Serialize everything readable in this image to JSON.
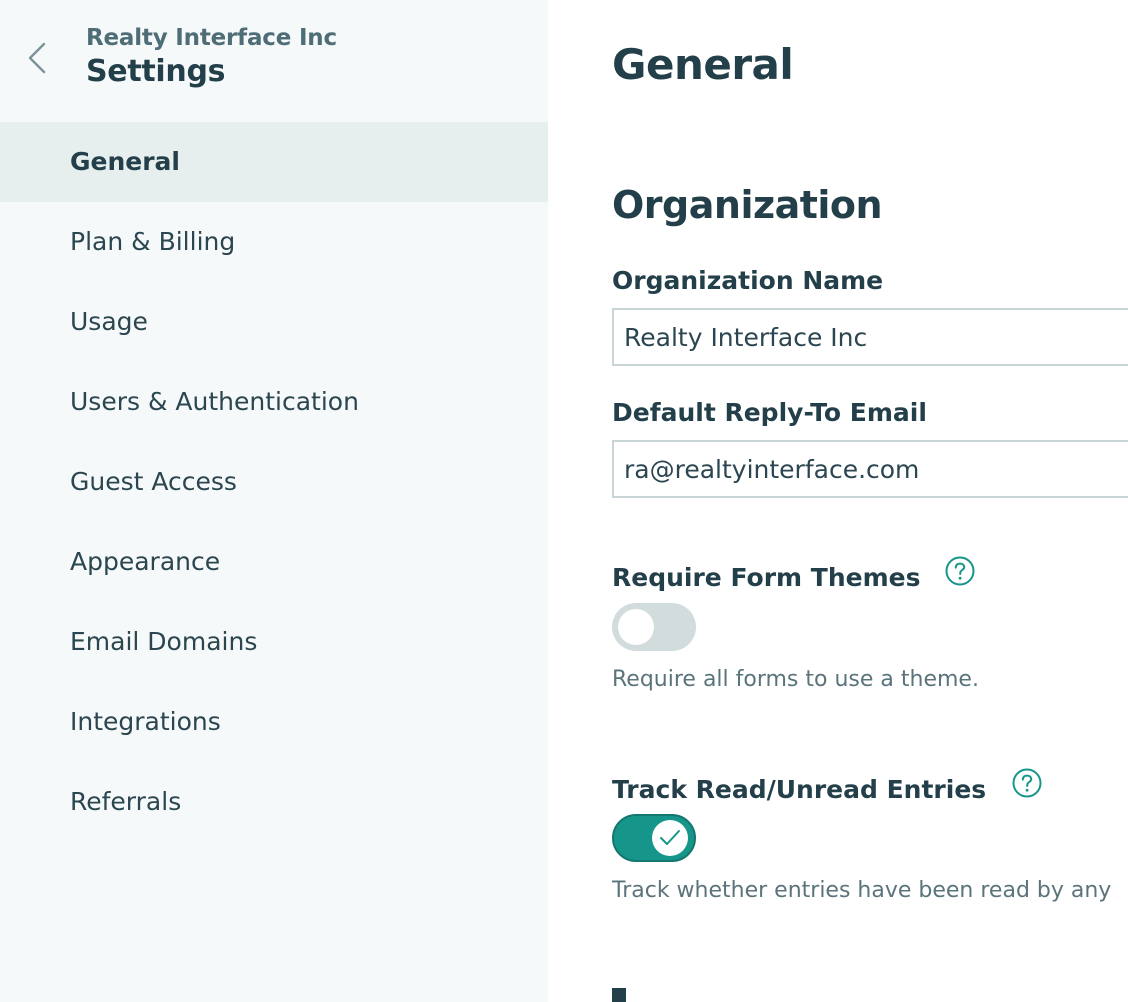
{
  "sidebar": {
    "org_name": "Realty Interface Inc",
    "title": "Settings",
    "items": [
      {
        "label": "General",
        "active": true
      },
      {
        "label": "Plan & Billing",
        "active": false
      },
      {
        "label": "Usage",
        "active": false
      },
      {
        "label": "Users & Authentication",
        "active": false
      },
      {
        "label": "Guest Access",
        "active": false
      },
      {
        "label": "Appearance",
        "active": false
      },
      {
        "label": "Email Domains",
        "active": false
      },
      {
        "label": "Integrations",
        "active": false
      },
      {
        "label": "Referrals",
        "active": false
      }
    ]
  },
  "main": {
    "page_title": "General",
    "section_title": "Organization",
    "org_name_field": {
      "label": "Organization Name",
      "value": "Realty Interface Inc"
    },
    "reply_email_field": {
      "label": "Default Reply-To Email",
      "value": "ra@realtyinterface.com"
    },
    "require_themes": {
      "label": "Require Form Themes",
      "enabled": false,
      "description": "Require all forms to use a theme."
    },
    "track_entries": {
      "label": "Track Read/Unread Entries",
      "enabled": true,
      "description": "Track whether entries have been read by any"
    }
  },
  "colors": {
    "accent": "#16968a",
    "sidebar_bg": "#f6f9f9",
    "active_item_bg": "#e7eeee",
    "heading": "#233f49"
  }
}
